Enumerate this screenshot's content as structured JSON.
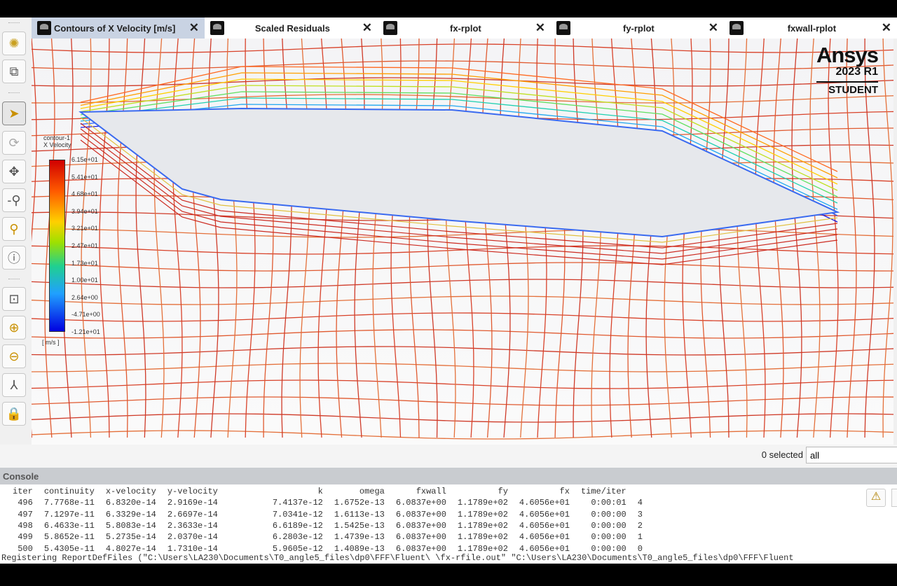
{
  "tabs": [
    {
      "label": "Contours of X Velocity [m/s]",
      "active": true
    },
    {
      "label": "Scaled Residuals"
    },
    {
      "label": "fx-rplot"
    },
    {
      "label": "fy-rplot"
    },
    {
      "label": "fxwall-rplot"
    }
  ],
  "logo": {
    "brand": "Ansys",
    "version": "2023 R1",
    "edition": "STUDENT"
  },
  "legend": {
    "title1": "contour-1",
    "title2": "X Velocity",
    "unit": "[ m/s ]",
    "ticks": [
      "6.15e+01",
      "5.41e+01",
      "4.68e+01",
      "3.94e+01",
      "3.21e+01",
      "2.47e+01",
      "1.73e+01",
      "1.00e+01",
      "2.64e+00",
      "-4.71e+00",
      "-1.21e+01"
    ]
  },
  "toolbar": [
    "display-icon",
    "view-cube-icon",
    "select-arrow-icon",
    "rotate-icon",
    "pan-icon",
    "zoom-icon",
    "zoom-box-icon",
    "probe-info-icon",
    "fit-icon",
    "zoom-in-icon",
    "zoom-out-icon",
    "axes-icon",
    "lock-icon"
  ],
  "selection": {
    "count_label": "0 selected",
    "filter_value": "all"
  },
  "console": {
    "title": "Console",
    "headers": [
      "iter",
      "continuity",
      "x-velocity",
      "y-velocity",
      "k",
      "omega",
      "fxwall",
      "fy",
      "fx",
      "time/iter",
      ""
    ],
    "rows": [
      [
        "496",
        "7.7768e-11",
        "6.8320e-14",
        "2.9169e-14",
        "7.4137e-12",
        "1.6752e-13",
        "6.0837e+00",
        "1.1789e+02",
        "4.6056e+01",
        "0:00:01",
        "4"
      ],
      [
        "497",
        "7.1297e-11",
        "6.3329e-14",
        "2.6697e-14",
        "7.0341e-12",
        "1.6113e-13",
        "6.0837e+00",
        "1.1789e+02",
        "4.6056e+01",
        "0:00:00",
        "3"
      ],
      [
        "498",
        "6.4633e-11",
        "5.8083e-14",
        "2.3633e-14",
        "6.6189e-12",
        "1.5425e-13",
        "6.0837e+00",
        "1.1789e+02",
        "4.6056e+01",
        "0:00:00",
        "2"
      ],
      [
        "499",
        "5.8652e-11",
        "5.2735e-14",
        "2.0370e-14",
        "6.2803e-12",
        "1.4739e-13",
        "6.0837e+00",
        "1.1789e+02",
        "4.6056e+01",
        "0:00:00",
        "1"
      ],
      [
        "500",
        "5.4305e-11",
        "4.8027e-14",
        "1.7310e-14",
        "5.9605e-12",
        "1.4089e-13",
        "6.0837e+00",
        "1.1789e+02",
        "4.6056e+01",
        "0:00:00",
        "0"
      ]
    ],
    "last_line": "Registering ReportDefFiles  (\"C:\\Users\\LA230\\Documents\\T0_angle5_files\\dp0\\FFF\\Fluent\\ \\fx-rfile.out\" \"C:\\Users\\LA230\\Documents\\T0_angle5_files\\dp0\\FFF\\Fluent"
  }
}
